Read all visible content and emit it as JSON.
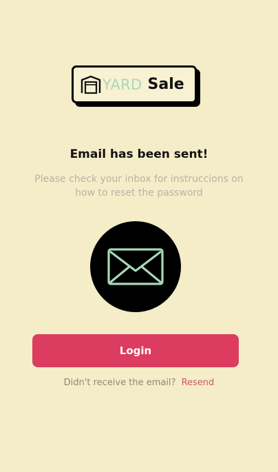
{
  "logo": {
    "word1": "YARD",
    "word2": "Sale",
    "icon": "garage-icon"
  },
  "title": "Email has been sent!",
  "subtitle": "Please check your inbox for instruccions on how to reset the password",
  "illustration": {
    "icon": "envelope-icon"
  },
  "login_button": "Login",
  "resend": {
    "prompt": "Didn't receive the email?",
    "link": "Resend"
  },
  "colors": {
    "background": "#f5edc8",
    "accent": "#db3c5f",
    "mint": "#a9d8b8",
    "link": "#c95866"
  }
}
